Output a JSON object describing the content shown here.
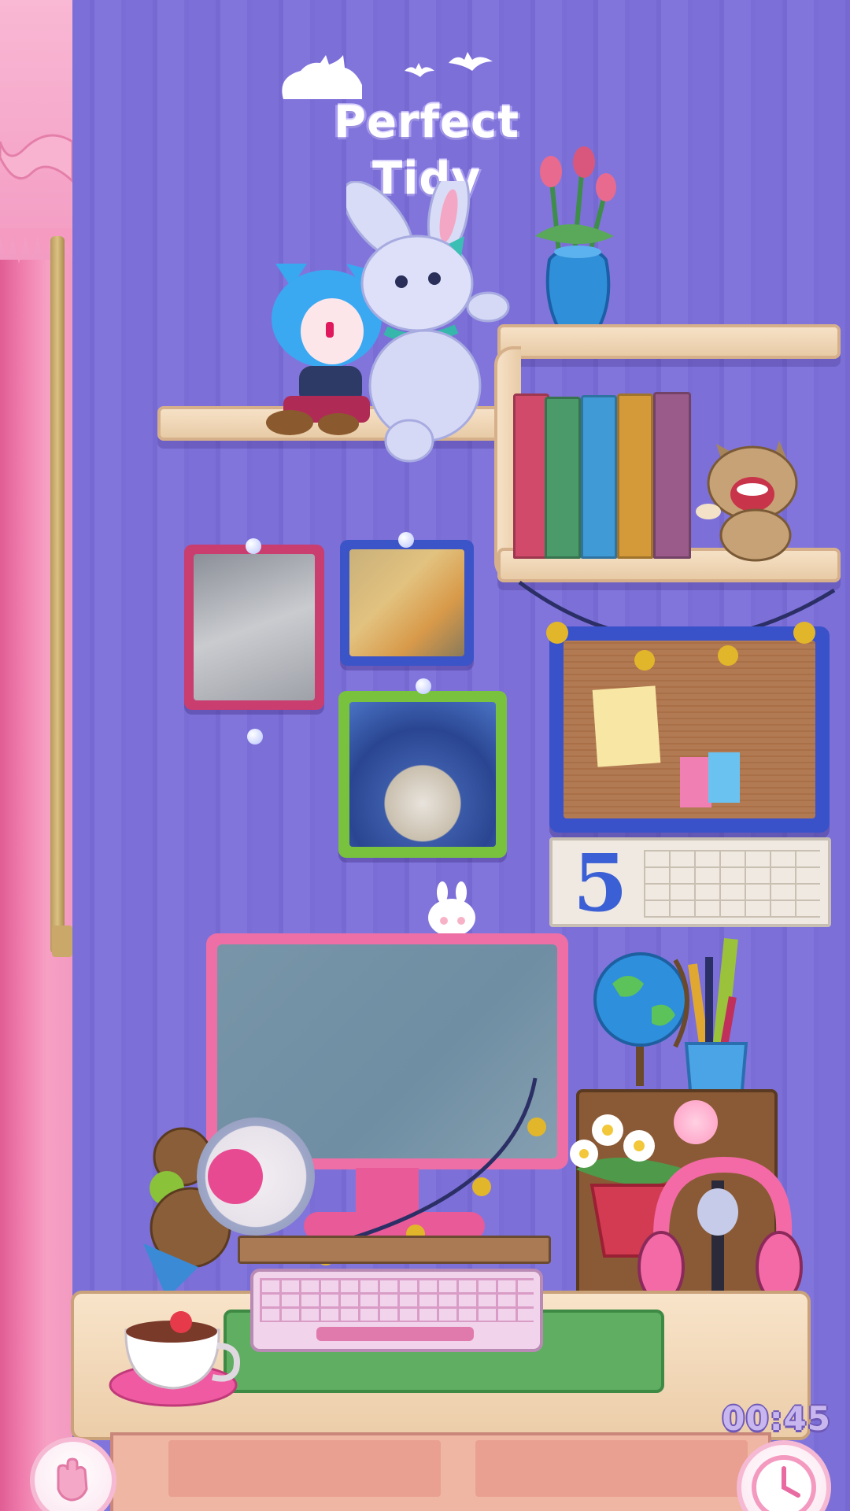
{
  "game": {
    "title": "Perfect Tidy",
    "timer": "00:45",
    "calendar_day": "5"
  },
  "colors": {
    "wall": "#7c70d8",
    "curtain": "#f07fae",
    "shelf": "#f3dcbf",
    "desk": "#f4dcc0",
    "monitor_frame": "#ee6fa6",
    "timer_text": "#c8b6ee"
  },
  "icons": {
    "hint_button": "hand-pointer-icon",
    "clock_button": "clock-icon",
    "logo_mascots": "cat-and-bats-icon"
  }
}
